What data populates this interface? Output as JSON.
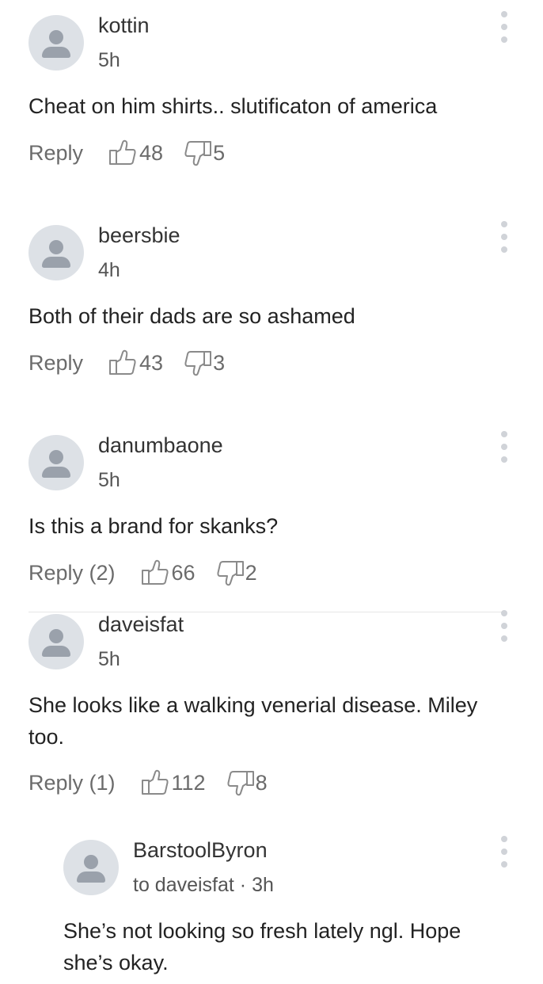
{
  "comments": [
    {
      "username": "kottin",
      "time": "5h",
      "text": "Cheat on him shirts.. slutificaton of america",
      "reply_label": "Reply",
      "likes": "48",
      "dislikes": "5"
    },
    {
      "username": "beersbie",
      "time": "4h",
      "text": "Both of their dads are so ashamed",
      "reply_label": "Reply",
      "likes": "43",
      "dislikes": "3"
    },
    {
      "username": "danumbaone",
      "time": "5h",
      "text": "Is this a brand for skanks?",
      "reply_label": "Reply (2)",
      "likes": "66",
      "dislikes": "2"
    },
    {
      "username": "daveisfat",
      "time": "5h",
      "text": "She looks like a walking venerial disease. Miley too.",
      "reply_label": "Reply (1)",
      "likes": "112",
      "dislikes": "8"
    },
    {
      "username": "BarstoolByron",
      "time": "to daveisfat · 3h",
      "text": "She’s not looking so fresh lately ngl. Hope she’s okay."
    }
  ],
  "icons": {
    "avatar": "user-placeholder-icon",
    "like": "thumbs-up-icon",
    "dislike": "thumbs-down-icon",
    "more": "more-vertical-icon"
  },
  "colors": {
    "avatar_bg": "#dde1e6",
    "avatar_figure": "#9aa1ab",
    "action_text": "#6b6b6b"
  }
}
